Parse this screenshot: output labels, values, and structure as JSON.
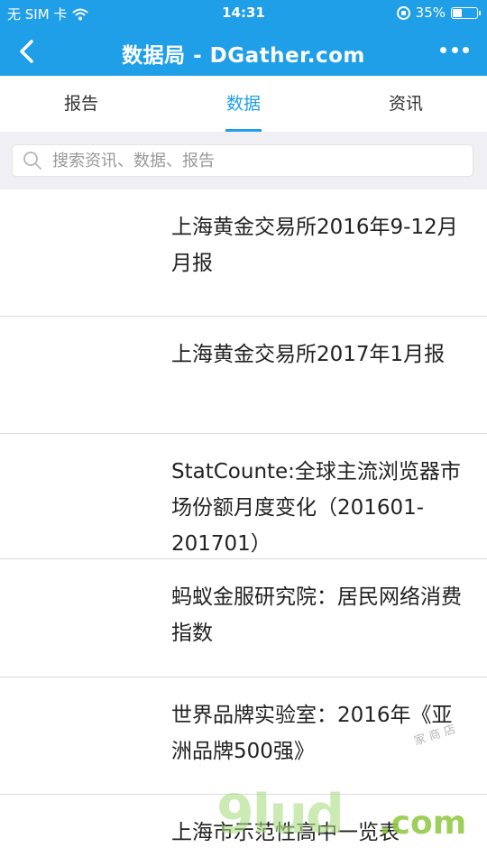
{
  "status_bar": {
    "carrier": "无 SIM 卡",
    "time": "14:31",
    "battery": "35%",
    "battery_level": 0.35
  },
  "nav": {
    "title": "数据局 - DGather.com",
    "back_icon": "chevron-left-icon",
    "more_icon": "more-dots-icon"
  },
  "tabs": [
    {
      "label": "报告",
      "active": false
    },
    {
      "label": "数据",
      "active": true
    },
    {
      "label": "资讯",
      "active": false
    }
  ],
  "search": {
    "placeholder": "搜索资讯、数据、报告"
  },
  "list": [
    {
      "title": "上海黄金交易所2016年9-12月月报"
    },
    {
      "title": "上海黄金交易所2017年1月报"
    },
    {
      "title": "StatCounte:全球主流浏览器市场份额月度变化（201601-201701）"
    },
    {
      "title": "蚂蚁金服研究院：居民网络消费指数"
    },
    {
      "title": "世界品牌实验室：2016年《亚洲品牌500强》"
    },
    {
      "title": "上海市示范性高中一览表"
    }
  ],
  "watermark": {
    "main": "9lud",
    "suffix": ".com",
    "small": "家 商 店"
  },
  "colors": {
    "primary": "#1f9fe8",
    "background": "#efeff4"
  }
}
